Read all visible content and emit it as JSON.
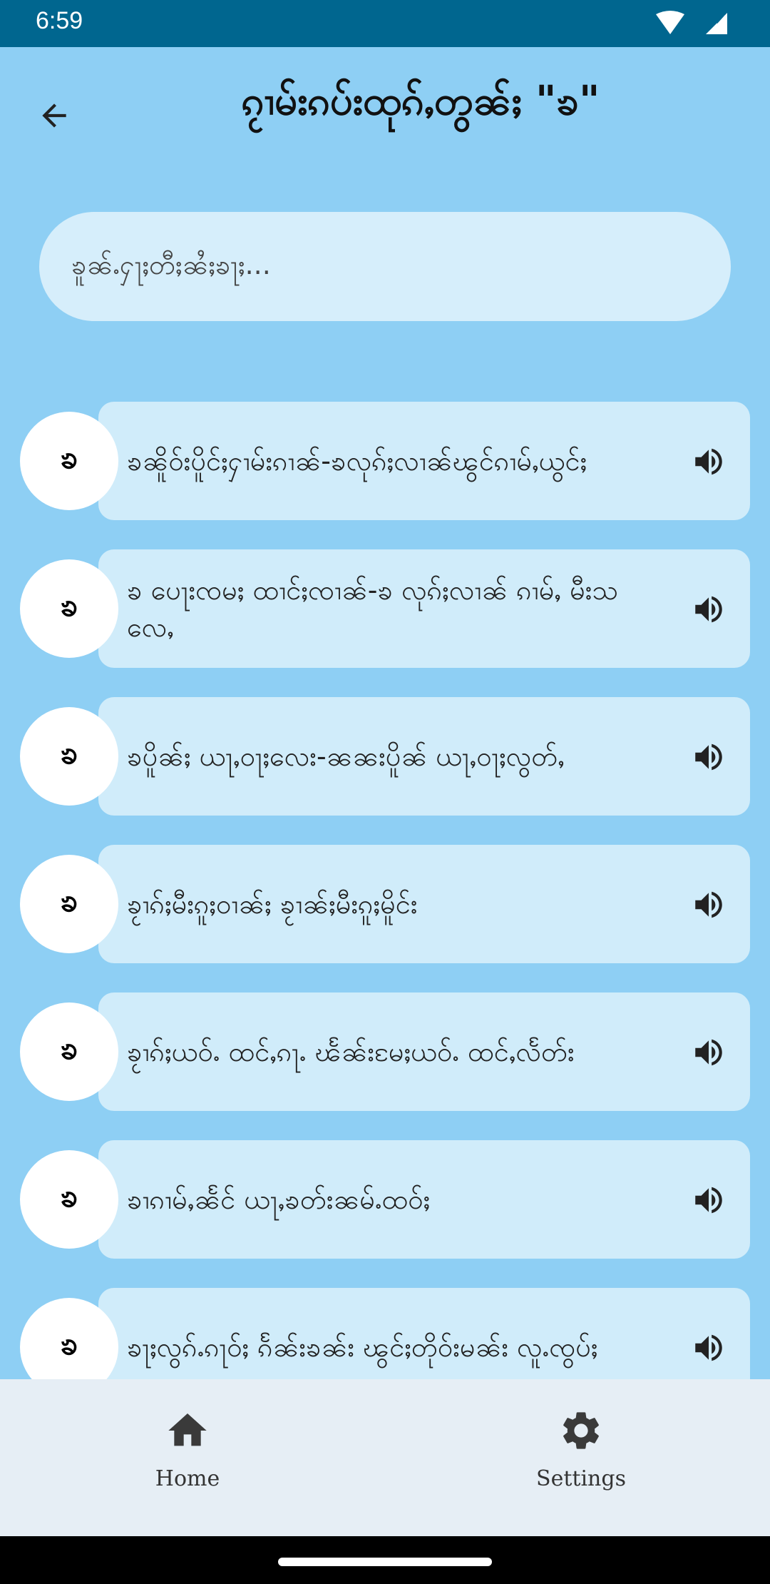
{
  "status_bar": {
    "time": "6:59"
  },
  "header": {
    "title": "ၵႂၢမ်းၵပ်းထုၵ်ႇတွၼ်ႈ \"ၶ\""
  },
  "search": {
    "placeholder": "ၶူၼ်ႉႁႃႈတီႈၼႆႈၶႃႈ..."
  },
  "list": {
    "items": [
      {
        "letter": "ၶ",
        "text": "ၶၼိူဝ်းပိူင်ႈႁၢမ်းၵၢၼ်-ၶလုၵ်ႈလၢၼ်ၽွင်ၵၢမ်ႇယွင်ႈ"
      },
      {
        "letter": "ၶ",
        "text": "ၶ ပေႃးၸမႈ ထၢင်ႈၸၢၼ်-ၶ လုၵ်ႈလၢၼ် ၵၢမ်ႇ မီးသလေႇ"
      },
      {
        "letter": "ၶ",
        "text": "ၶပိူၼ်ႈ ယႃႇဝႃႈလေး-ၼၼးပိူၼ် ယႃႇဝႃႈလွတ်ႇ"
      },
      {
        "letter": "ၶ",
        "text": "ၶႂၢၵ်ႈမီးၵူႈဝၢၼ်ႈ ၶႂၢၼ်ႈမီးၵူႈမိူင်း"
      },
      {
        "letter": "ၶ",
        "text": "ၶႂၢၵ်ႈယဝ်ႉ ထင်ႇၵႃႉ ၽႅၼ်းမႄႈယဝ်ႉ ထင်ႇလႅတ်း"
      },
      {
        "letter": "ၶ",
        "text": "ၶၢၵၢမ်ႇၼႅင် ယႃႇၶတ်းၼမ်ႉထဝ်ႈ"
      },
      {
        "letter": "ၶ",
        "text": "ၶႃႈလွၵ်ႉၵႃဝ်ႈ ၵႅၼ်းၶၼ်း ၽွင်ႈတိုဝ်းမၼ်း လူႉၸွပ်ႈ"
      }
    ]
  },
  "bottom_nav": {
    "home_label": "Home",
    "settings_label": "Settings"
  },
  "colors": {
    "status_bar": "#00668f",
    "background": "#8ecff4",
    "card": "#d0ecfa",
    "search": "#d6eefb",
    "nav": "#e6eef5"
  }
}
